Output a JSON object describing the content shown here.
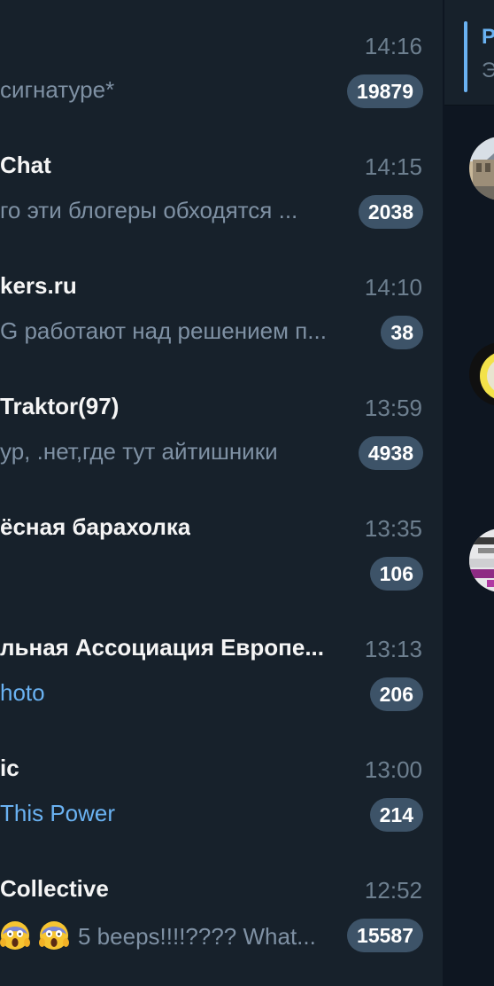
{
  "chats": [
    {
      "name": "",
      "time": "14:16",
      "preview": "сигнатуре*",
      "badge": "19879",
      "preview_style": "text"
    },
    {
      "name": "Chat",
      "time": "14:15",
      "preview": "го эти блогеры обходятся ...",
      "badge": "2038",
      "preview_style": "text"
    },
    {
      "name": "kers.ru",
      "time": "14:10",
      "preview": "G работают над решением п...",
      "badge": "38",
      "preview_style": "text"
    },
    {
      "name": "Traktor(97)",
      "time": "13:59",
      "preview": "ур, .нет,где тут айтишники",
      "badge": "4938",
      "preview_style": "text"
    },
    {
      "name": "ёсная барахолка",
      "time": "13:35",
      "preview": "",
      "badge": "106",
      "preview_style": "text"
    },
    {
      "name": "льная Ассоциация Европе...",
      "time": "13:13",
      "preview": "hoto",
      "badge": "206",
      "preview_style": "media"
    },
    {
      "name": "ic",
      "time": "13:00",
      "preview": "This Power",
      "badge": "214",
      "preview_style": "media"
    },
    {
      "name": "Collective",
      "time": "12:52",
      "preview": "5 beeps!!!!???? What...",
      "badge": "15587",
      "preview_style": "text",
      "emojis": [
        "face-screaming-in-fear",
        "face-screaming-in-fear"
      ]
    }
  ],
  "pinned": {
    "title": "P",
    "subtitle": "Э"
  },
  "colors": {
    "sidebar_bg": "#17212b",
    "chat_bg": "#0e1621",
    "badge_bg": "#3d5368",
    "accent": "#6ab2f2",
    "name_text": "#f5f5f5",
    "time_text": "#6d7f8f",
    "preview_text": "#7f91a4"
  }
}
